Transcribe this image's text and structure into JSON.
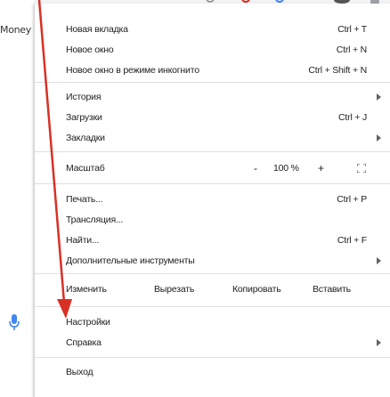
{
  "background": {
    "money_text": "Money",
    "mic_icon": "microphone-icon"
  },
  "menu": {
    "new_tab": {
      "label": "Новая вкладка",
      "shortcut": "Ctrl + T"
    },
    "new_window": {
      "label": "Новое окно",
      "shortcut": "Ctrl + N"
    },
    "incognito": {
      "label": "Новое окно в режиме инкогнито",
      "shortcut": "Ctrl + Shift + N"
    },
    "history": {
      "label": "История"
    },
    "downloads": {
      "label": "Загрузки",
      "shortcut": "Ctrl + J"
    },
    "bookmarks": {
      "label": "Закладки"
    },
    "zoom": {
      "label": "Масштаб",
      "minus": "-",
      "value": "100 %",
      "plus": "+"
    },
    "print": {
      "label": "Печать...",
      "shortcut": "Ctrl + P"
    },
    "cast": {
      "label": "Трансляция..."
    },
    "find": {
      "label": "Найти...",
      "shortcut": "Ctrl + F"
    },
    "more_tools": {
      "label": "Дополнительные инструменты"
    },
    "edit": {
      "label": "Изменить",
      "cut": "Вырезать",
      "copy": "Копировать",
      "paste": "Вставить"
    },
    "settings": {
      "label": "Настройки"
    },
    "help": {
      "label": "Справка"
    },
    "exit": {
      "label": "Выход"
    }
  },
  "colors": {
    "arrow_red": "#d93025",
    "separator": "#e0e0e0",
    "text": "#202124"
  }
}
